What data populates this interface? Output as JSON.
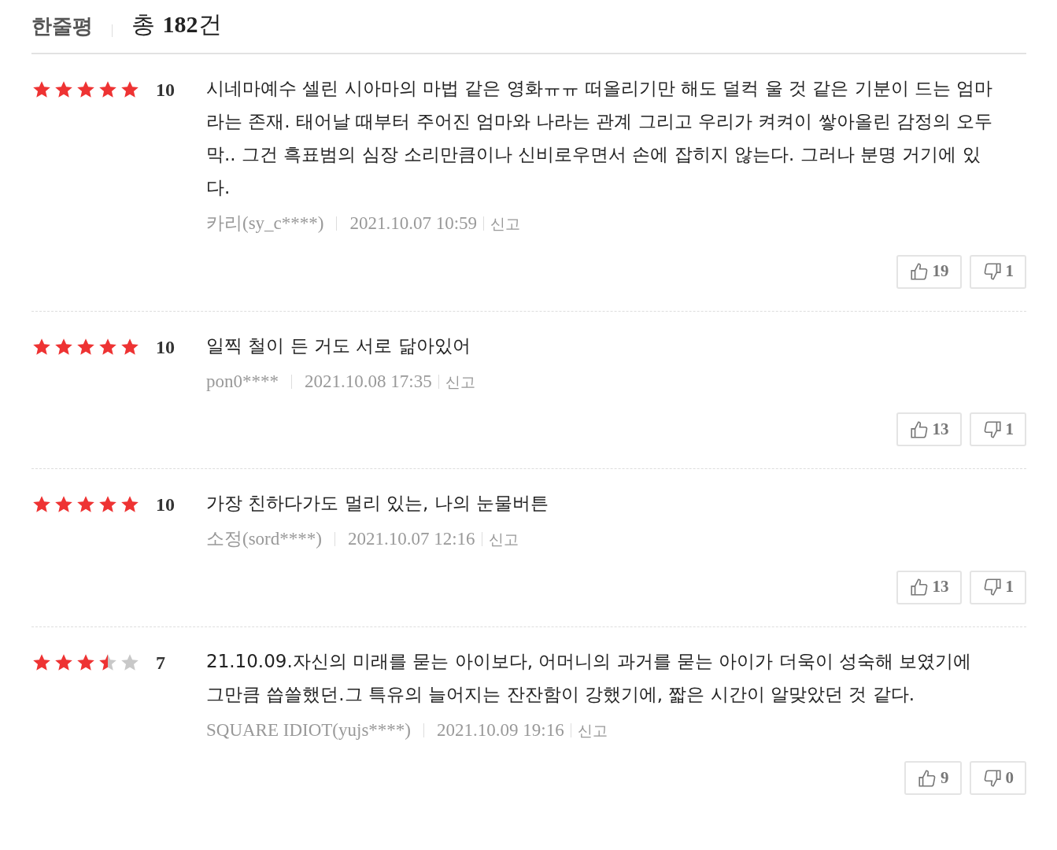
{
  "header": {
    "title": "한줄평",
    "total_prefix": "총",
    "total_count": "182",
    "total_suffix": "건"
  },
  "reviews": [
    {
      "stars": 5,
      "score": "10",
      "text": "시네마예수 셀린 시아마의 마법 같은 영화ㅠㅠ 떠올리기만 해도 덜컥 울 것 같은 기분이 드는 엄마라는 존재. 태어날 때부터 주어진 엄마와 나라는 관계 그리고 우리가 켜켜이 쌓아올린 감정의 오두막.. 그건 흑표범의 심장 소리만큼이나 신비로우면서 손에 잡히지 않는다. 그러나 분명 거기에 있다.",
      "author": "카리(sy_c****)",
      "date": "2021.10.07 10:59",
      "report": "신고",
      "likes": "19",
      "dislikes": "1"
    },
    {
      "stars": 5,
      "score": "10",
      "text": "일찍 철이 든 거도 서로 닮아있어",
      "author": "pon0****",
      "date": "2021.10.08 17:35",
      "report": "신고",
      "likes": "13",
      "dislikes": "1"
    },
    {
      "stars": 5,
      "score": "10",
      "text": "가장 친하다가도 멀리 있는, 나의 눈물버튼",
      "author": "소정(sord****)",
      "date": "2021.10.07 12:16",
      "report": "신고",
      "likes": "13",
      "dislikes": "1"
    },
    {
      "stars": 3.5,
      "score": "7",
      "text": "21.10.09.자신의 미래를 묻는 아이보다, 어머니의 과거를 묻는 아이가 더욱이 성숙해 보였기에 그만큼 씁쓸했던.그 특유의 늘어지는 잔잔함이 강했기에, 짧은 시간이 알맞았던 것 같다.",
      "author": "SQUARE IDIOT(yujs****)",
      "date": "2021.10.09 19:16",
      "report": "신고",
      "likes": "9",
      "dislikes": "0"
    }
  ]
}
